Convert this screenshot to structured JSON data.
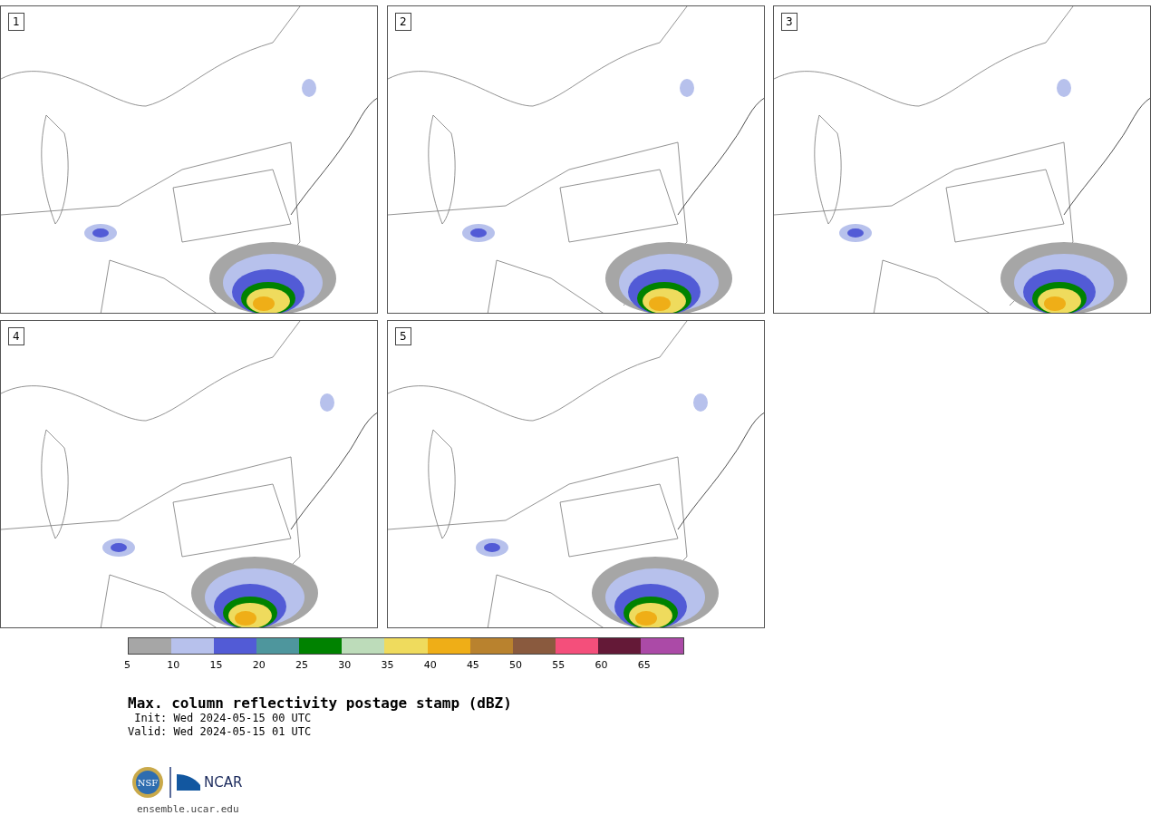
{
  "panels": [
    {
      "label": "1"
    },
    {
      "label": "2"
    },
    {
      "label": "3"
    },
    {
      "label": "4"
    },
    {
      "label": "5"
    }
  ],
  "colorbar": {
    "segments": [
      {
        "color": "#a6a6a6",
        "tick": "5"
      },
      {
        "color": "#b7c1ec",
        "tick": "10"
      },
      {
        "color": "#525bd6",
        "tick": "15"
      },
      {
        "color": "#4e969d",
        "tick": "20"
      },
      {
        "color": "#008200",
        "tick": "25"
      },
      {
        "color": "#bddcba",
        "tick": "30"
      },
      {
        "color": "#efdb5d",
        "tick": "35"
      },
      {
        "color": "#efae17",
        "tick": "40"
      },
      {
        "color": "#b9822e",
        "tick": "45"
      },
      {
        "color": "#8a5a3e",
        "tick": "50"
      },
      {
        "color": "#f44f7b",
        "tick": "55"
      },
      {
        "color": "#641937",
        "tick": "60"
      },
      {
        "color": "#ab4aa7",
        "tick": "65"
      }
    ]
  },
  "title": "Max. column reflectivity postage stamp (dBZ)",
  "init": " Init: Wed 2024-05-15 00 UTC",
  "valid": "Valid: Wed 2024-05-15 01 UTC",
  "logos": {
    "nsf": "NSF",
    "ncar": "NCAR"
  },
  "link": "ensemble.ucar.edu"
}
